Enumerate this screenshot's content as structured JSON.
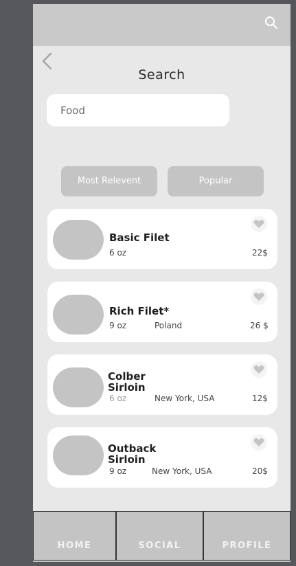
{
  "header": {
    "title": "Search"
  },
  "search": {
    "value": "Food"
  },
  "filters": [
    "Most Relevent",
    "Popular"
  ],
  "items": [
    {
      "name_line1": "Basic Filet",
      "name_line2": "",
      "weight": "6 oz",
      "location": "",
      "price": "22$"
    },
    {
      "name_line1": "Rich Filet*",
      "name_line2": "",
      "weight": "9 oz",
      "location": "Poland",
      "price": "26 $"
    },
    {
      "name_line1": "Colber",
      "name_line2": "Sirloin",
      "weight": "6 oz",
      "location": "New York, USA",
      "price": "12$"
    },
    {
      "name_line1": "Outback",
      "name_line2": "Sirloin",
      "weight": "9 oz",
      "location": "New York, USA",
      "price": "20$"
    }
  ],
  "nav": {
    "home": "HOME",
    "social": "SOCIAL",
    "profile": "PROFILE"
  },
  "icons": {
    "search": "search-icon",
    "back": "chevron-left-icon",
    "favorite": "heart-icon"
  },
  "colors": {
    "background": "#55575b",
    "screen": "#e8e8e8",
    "topbar": "#c9c9c9",
    "placeholder_gray": "#c4c4c4",
    "card": "#ffffff"
  }
}
